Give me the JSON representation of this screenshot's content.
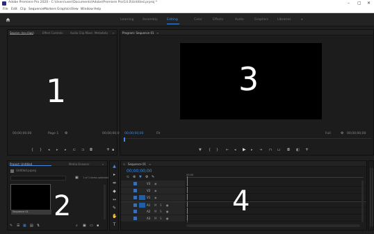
{
  "titlebar": {
    "title": "Adobe Premiere Pro 2020 - C:\\Users\\user\\Documents\\Adobe\\Premiere Pro\\14.0\\Untitled.prproj *",
    "minimize": "–",
    "maximize": "▢",
    "close": "✕"
  },
  "menubar": {
    "items": [
      "File",
      "Edit",
      "Clip",
      "Sequence",
      "Markers",
      "Graphics",
      "View",
      "Window",
      "Help"
    ]
  },
  "workspaces": {
    "tabs": [
      "Learning",
      "Assembly",
      "Editing",
      "Color",
      "Effects",
      "Audio",
      "Graphics",
      "Libraries"
    ],
    "active": "Editing",
    "more": "»"
  },
  "source_panel": {
    "tabs": [
      "Source: (no clips)",
      "Effect Controls",
      "Audio Clip Mixer",
      "Metadata"
    ],
    "more": "»",
    "timecode": "00;00;00;00",
    "page": "Page 1",
    "duration": "00;00;00;00",
    "label_number": "1"
  },
  "program_panel": {
    "tab": "Program: Sequence 01",
    "menu": "≡",
    "timecode": "00;00;00;00",
    "fit": "Fit",
    "quality": "Full",
    "duration": "00;00;00;00",
    "label_number": "3"
  },
  "project_panel": {
    "tabs": [
      "Project: Untitled",
      "Media Browser"
    ],
    "more": "»",
    "project_file": "Untitled.prproj",
    "search_placeholder": "",
    "item_count": "1 of 1 items selected",
    "thumb_label": "Sequence 01",
    "label_number": "2"
  },
  "timeline_panel": {
    "tab": "Sequence 01",
    "menu": "≡",
    "timecode": "00;00;00;00",
    "ruler_start": "00;00",
    "tracks": [
      "V3",
      "V2",
      "V1",
      "A1",
      "A2",
      "A3"
    ],
    "label_number": "4"
  },
  "colors": {
    "accent": "#3f8ce8",
    "panel_bg": "#1c1c1c",
    "frame_bg": "#000000"
  }
}
